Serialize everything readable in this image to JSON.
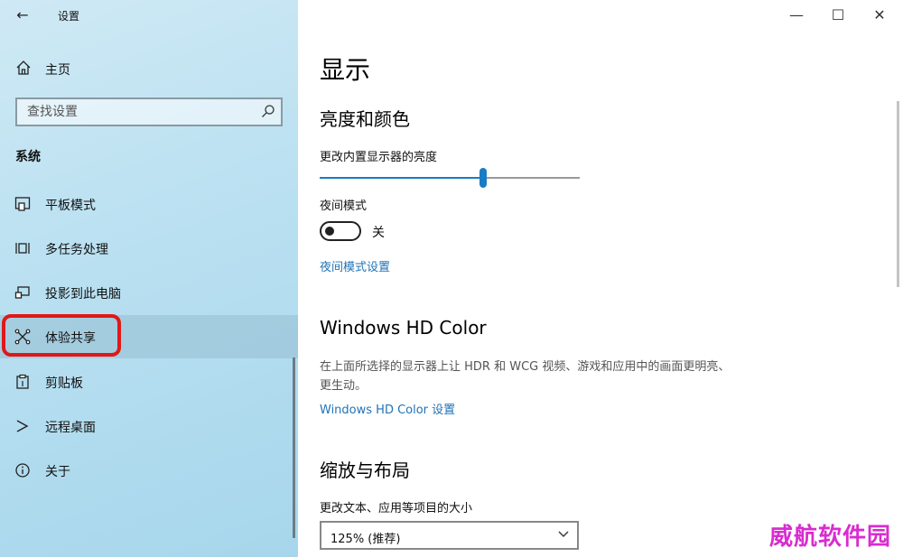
{
  "window": {
    "title": "设置",
    "back": "←",
    "minimize": "—",
    "maximize": "☐",
    "close": "✕"
  },
  "sidebar": {
    "home_label": "主页",
    "search_placeholder": "查找设置",
    "section": "系统",
    "items": [
      {
        "label": "平板模式",
        "icon": "tablet-mode-icon"
      },
      {
        "label": "多任务处理",
        "icon": "multitasking-icon"
      },
      {
        "label": "投影到此电脑",
        "icon": "projecting-icon"
      },
      {
        "label": "体验共享",
        "icon": "shared-experiences-icon",
        "active": true
      },
      {
        "label": "剪贴板",
        "icon": "clipboard-icon"
      },
      {
        "label": "远程桌面",
        "icon": "remote-desktop-icon"
      },
      {
        "label": "关于",
        "icon": "about-icon"
      }
    ]
  },
  "main": {
    "title": "显示",
    "brightness_section": "亮度和颜色",
    "brightness_label": "更改内置显示器的亮度",
    "brightness_level": 0.63,
    "night_mode_label": "夜间模式",
    "night_mode_state": "关",
    "night_mode_link": "夜间模式设置",
    "hd_section": "Windows HD Color",
    "hd_desc": "在上面所选择的显示器上让 HDR 和 WCG 视频、游戏和应用中的画面更明亮、更生动。",
    "hd_link": "Windows HD Color 设置",
    "scale_section": "缩放与布局",
    "scale_label": "更改文本、应用等项目的大小",
    "scale_value": "125% (推荐)"
  },
  "watermark": "威航软件园",
  "colors": {
    "accent": "#1a7cc4",
    "link": "#1f73b8",
    "highlight": "#e01818",
    "watermark": "#d92cd0"
  }
}
